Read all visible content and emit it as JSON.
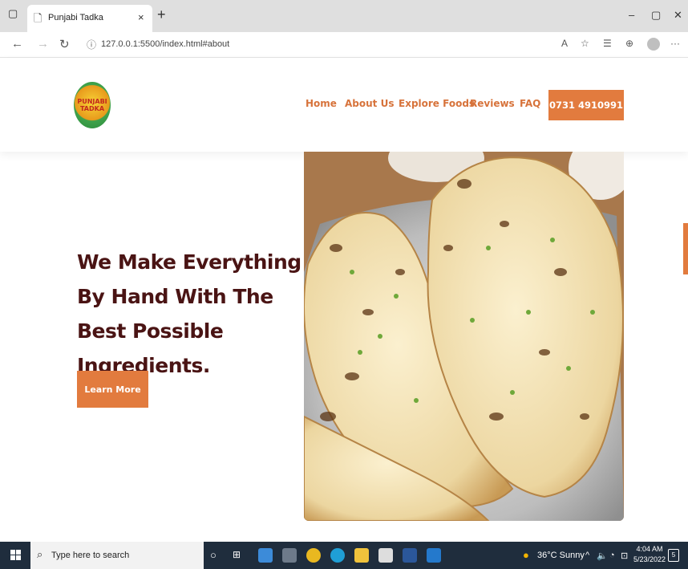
{
  "browser": {
    "tab_title": "Punjabi Tadka",
    "tab_close": "×",
    "new_tab": "+",
    "url": "127.0.0.1:5500/index.html#about",
    "window_controls": [
      "–",
      "▢",
      "✕"
    ]
  },
  "site": {
    "logo_text": "PUNJABI TADKA",
    "nav": {
      "home": "Home",
      "about": "About Us",
      "explore": "Explore Foods",
      "reviews": "Reviews",
      "faq": "FAQ"
    },
    "phone": "0731 4910991",
    "accent_color": "#e27b3e",
    "nav_color": "#d7733b",
    "heading_color": "#4a1414"
  },
  "hero": {
    "title": "We Make Everything By Hand With The Best Possible Ingredients.",
    "button_label": "Learn More",
    "image_subject": "naan bread on foil"
  },
  "taskbar": {
    "search_placeholder": "Type here to search",
    "weather": "36°C  Sunny",
    "time": "4:04 AM",
    "date": "5/23/2022",
    "notifications": "5"
  }
}
